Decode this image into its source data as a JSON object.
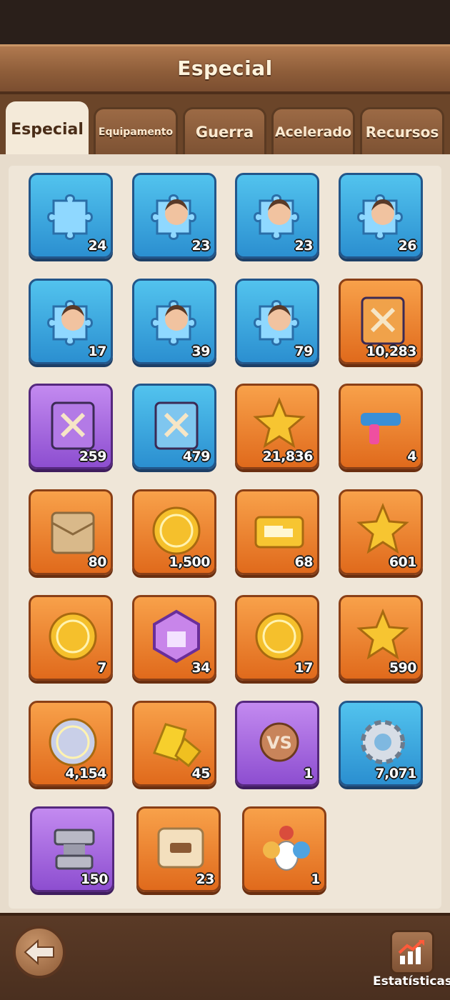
{
  "header": {
    "title": "Especial"
  },
  "tabs": [
    {
      "label": "Especial",
      "active": true
    },
    {
      "label": "Equipamento",
      "active": false
    },
    {
      "label": "Guerra",
      "active": false
    },
    {
      "label": "Acelerado",
      "active": false
    },
    {
      "label": "Recursos",
      "active": false
    }
  ],
  "items": [
    {
      "name": "puzzle-piece-icon",
      "color": "blue",
      "count": "24"
    },
    {
      "name": "hero-puzzle-dark-hair-woman-icon",
      "color": "blue",
      "count": "23"
    },
    {
      "name": "hero-puzzle-angry-brute-icon",
      "color": "blue",
      "count": "23"
    },
    {
      "name": "hero-puzzle-bearded-man-icon",
      "color": "blue",
      "count": "26"
    },
    {
      "name": "hero-puzzle-old-elf-icon",
      "color": "blue",
      "count": "17"
    },
    {
      "name": "hero-puzzle-blonde-woman-icon",
      "color": "blue",
      "count": "39"
    },
    {
      "name": "hero-puzzle-red-hair-woman-icon",
      "color": "blue",
      "count": "79"
    },
    {
      "name": "orange-skill-book-icon",
      "color": "orange",
      "count": "10,283"
    },
    {
      "name": "purple-skill-book-icon",
      "color": "purple",
      "count": "259"
    },
    {
      "name": "blue-skill-book-icon",
      "color": "blue",
      "count": "479"
    },
    {
      "name": "star-orb-medal-icon",
      "color": "orange",
      "count": "21,836"
    },
    {
      "name": "blaster-gun-icon",
      "color": "orange",
      "count": "4"
    },
    {
      "name": "envelope-pack-icon",
      "color": "orange",
      "count": "80"
    },
    {
      "name": "crossed-swords-coin-icon",
      "color": "orange",
      "count": "1,500"
    },
    {
      "name": "truck-ticket-icon",
      "color": "orange",
      "count": "68"
    },
    {
      "name": "gold-star-medal-icon",
      "color": "orange",
      "count": "601"
    },
    {
      "name": "skull-coin-icon",
      "color": "orange",
      "count": "7"
    },
    {
      "name": "purple-crate-badge-icon",
      "color": "orange",
      "count": "34"
    },
    {
      "name": "clover-coin-icon",
      "color": "orange",
      "count": "17"
    },
    {
      "name": "star-ribbon-medal-icon",
      "color": "orange",
      "count": "590"
    },
    {
      "name": "flag-silver-coin-icon",
      "color": "orange",
      "count": "4,154"
    },
    {
      "name": "gold-nugget-icon",
      "color": "orange",
      "count": "45"
    },
    {
      "name": "vs-badge-icon",
      "color": "purple",
      "count": "1"
    },
    {
      "name": "silver-gear-icon",
      "color": "blue",
      "count": "7,071"
    },
    {
      "name": "anvil-icon",
      "color": "purple",
      "count": "150"
    },
    {
      "name": "tank-scroll-icon",
      "color": "orange",
      "count": "23"
    },
    {
      "name": "pets-group-icon",
      "color": "orange",
      "count": "1"
    }
  ],
  "footer": {
    "back_icon": "back-arrow-icon",
    "stats_icon": "chart-up-icon",
    "stats_label": "Estatísticas"
  }
}
